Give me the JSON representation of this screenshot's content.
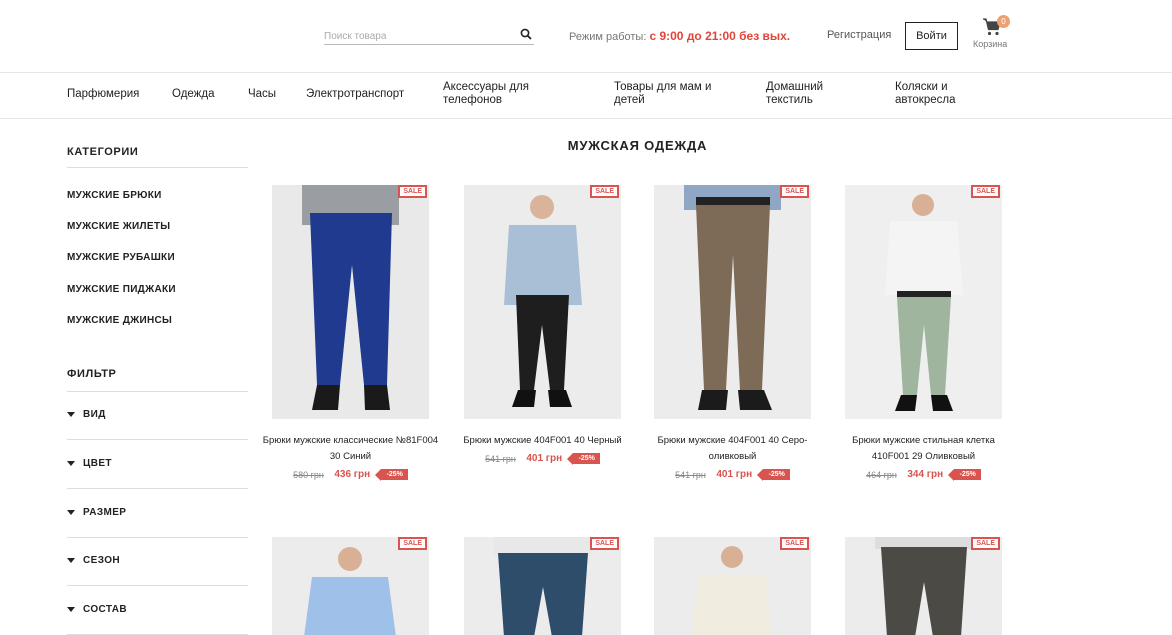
{
  "header": {
    "search_placeholder": "Поиск товара",
    "hours_label": "Режим работы:",
    "hours_value": "с 9:00 до 21:00 без вых.",
    "register": "Регистрация",
    "login": "Войти",
    "cart_count": "0",
    "cart_label": "Корзина"
  },
  "nav": {
    "items": [
      {
        "label": "Парфюмерия"
      },
      {
        "label": "Одежда"
      },
      {
        "label": "Часы"
      },
      {
        "label": "Электротранспорт"
      },
      {
        "label": "Аксессуары для телефонов"
      },
      {
        "label": "Товары для мам и детей"
      },
      {
        "label": "Домашний текстиль"
      },
      {
        "label": "Коляски и автокресла"
      }
    ]
  },
  "sidebar": {
    "categories_title": "КАТЕГОРИИ",
    "categories": [
      {
        "label": "МУЖСКИЕ БРЮКИ"
      },
      {
        "label": "МУЖСКИЕ ЖИЛЕТЫ"
      },
      {
        "label": "МУЖСКИЕ РУБАШКИ"
      },
      {
        "label": "МУЖСКИЕ ПИДЖАКИ"
      },
      {
        "label": "МУЖСКИЕ ДЖИНСЫ"
      }
    ],
    "filter_title": "ФИЛЬТР",
    "filters": [
      {
        "label": "ВИД"
      },
      {
        "label": "ЦВЕТ"
      },
      {
        "label": "РАЗМЕР"
      },
      {
        "label": "СЕЗОН"
      },
      {
        "label": "СОСТАВ"
      }
    ]
  },
  "main": {
    "title": "МУЖСКАЯ ОДЕЖДА",
    "sale_badge": "SALE",
    "products": [
      {
        "name": "Брюки мужские классические №81F004 30 Синий",
        "old_price": "580 грн",
        "price": "436 грн",
        "discount": "-25%",
        "shirt": "#9a9ea3",
        "pants": "#1f3a8f"
      },
      {
        "name": "Брюки мужские 404F001 40 Черный",
        "old_price": "541 грн",
        "price": "401 грн",
        "discount": "-25%",
        "shirt": "#a9bfd6",
        "pants": "#1e1e1e"
      },
      {
        "name": "Брюки мужские 404F001 40 Серо-оливковый",
        "old_price": "541 грн",
        "price": "401 грн",
        "discount": "-25%",
        "shirt": "#8fa6c4",
        "pants": "#7d6a57"
      },
      {
        "name": "Брюки мужские стильная клетка 410F001 29 Оливковый",
        "old_price": "464 грн",
        "price": "344 грн",
        "discount": "-25%",
        "shirt": "#f4f4f4",
        "pants": "#9fb59d"
      },
      {
        "shirt": "#9fc0e8",
        "pants": "#5a6b80"
      },
      {
        "shirt": "#e8e8e8",
        "pants": "#2e4d6a"
      },
      {
        "shirt": "#f1ece0",
        "pants": "#444444"
      },
      {
        "shirt": "#dddddd",
        "pants": "#4b4a45"
      }
    ]
  }
}
